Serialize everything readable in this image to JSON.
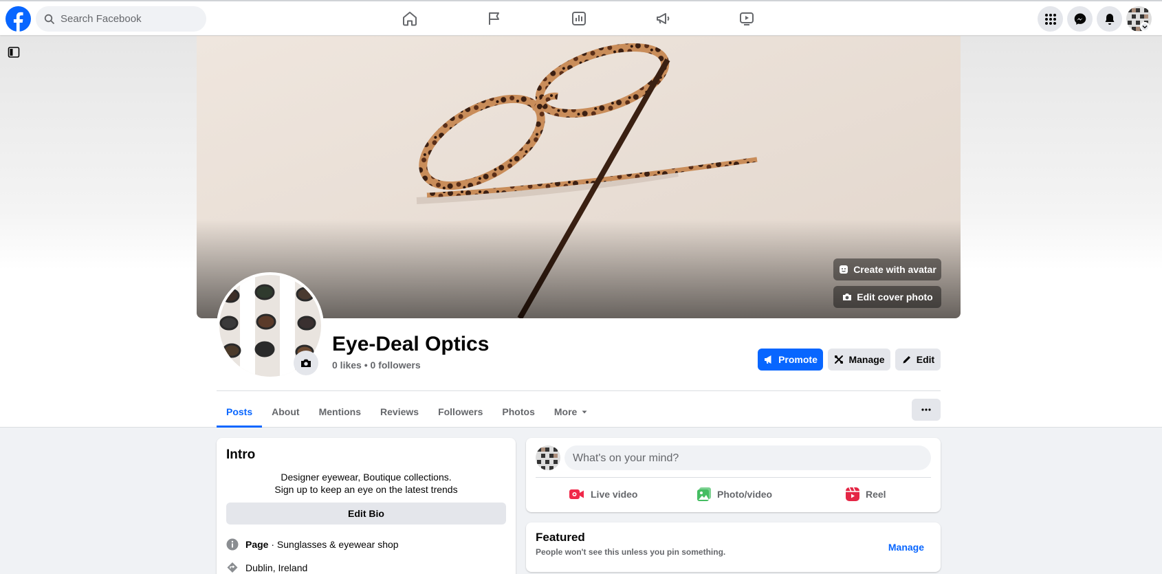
{
  "topbar": {
    "search_placeholder": "Search Facebook",
    "nav_icons": [
      "home-icon",
      "flag-icon",
      "insights-icon",
      "megaphone-icon",
      "watch-icon"
    ],
    "right_icons": [
      "menu-grid-icon",
      "messenger-icon",
      "bell-icon"
    ],
    "brand_color": "#0866ff"
  },
  "cover": {
    "create_avatar_label": "Create with avatar",
    "edit_cover_label": "Edit cover photo"
  },
  "profile": {
    "name": "Eye-Deal Optics",
    "stats": "0 likes • 0 followers"
  },
  "actions": {
    "promote_label": "Promote",
    "manage_label": "Manage",
    "edit_label": "Edit"
  },
  "tabs": [
    {
      "label": "Posts",
      "active": true
    },
    {
      "label": "About"
    },
    {
      "label": "Mentions"
    },
    {
      "label": "Reviews"
    },
    {
      "label": "Followers"
    },
    {
      "label": "Photos"
    },
    {
      "label": "More"
    }
  ],
  "intro": {
    "title": "Intro",
    "bio_line1": "Designer eyewear, Boutique collections.",
    "bio_line2": "Sign up to keep an eye on the latest trends",
    "edit_bio_label": "Edit Bio",
    "category_bold": "Page",
    "category_rest": " · Sunglasses & eyewear shop",
    "location": "Dublin, Ireland"
  },
  "composer": {
    "placeholder": "What's on your mind?",
    "live_label": "Live video",
    "photo_label": "Photo/video",
    "reel_label": "Reel"
  },
  "featured": {
    "title": "Featured",
    "subtitle": "People won't see this unless you pin something.",
    "manage_label": "Manage"
  }
}
